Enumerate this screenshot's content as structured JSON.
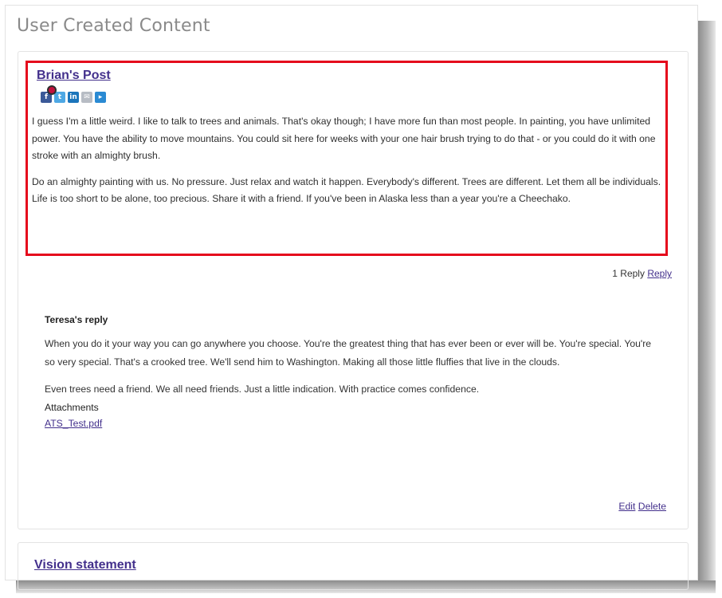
{
  "page": {
    "title": "User Created Content"
  },
  "post": {
    "title": "Brian's Post",
    "share_icons": [
      "facebook-icon",
      "twitter-icon",
      "linkedin-icon",
      "email-icon",
      "share-icon"
    ],
    "paragraphs": [
      "I guess I'm a little weird. I like to talk to trees and animals. That's okay though; I have more fun than most people. In painting, you have unlimited power. You have the ability to move mountains. You could sit here for weeks with your one hair brush trying to do that - or you could do it with one stroke with an almighty brush.",
      "Do an almighty painting with us. No pressure. Just relax and watch it happen. Everybody's different. Trees are different. Let them all be individuals. Life is too short to be alone, too precious. Share it with a friend. If you've been in Alaska less than a year you're a Cheechako."
    ],
    "reply_count": "1 Reply",
    "reply_link": "Reply",
    "highlight_color": "#e5081c"
  },
  "reply": {
    "title": "Teresa's reply",
    "paragraphs": [
      "When you do it your way you can go anywhere you choose. You're the greatest thing that has ever been or ever will be. You're special. You're so very special. That's a crooked tree. We'll send him to Washington. Making all those little fluffies that live in the clouds.",
      "Even trees need a friend. We all need friends. Just a little indication. With practice comes confidence."
    ],
    "attachments_label": "Attachments",
    "attachment": "ATS_Test.pdf",
    "edit_label": "Edit",
    "delete_label": "Delete"
  },
  "next_post": {
    "title": "Vision statement"
  },
  "colors": {
    "link": "#43308c",
    "title_gray": "#8a8a8a"
  }
}
